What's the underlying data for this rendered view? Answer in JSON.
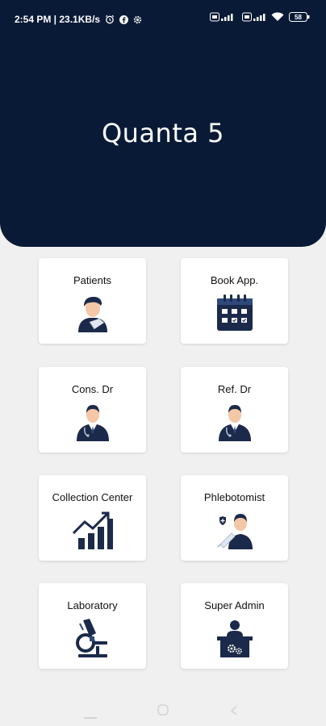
{
  "status_bar": {
    "time_and_speed": "2:54 PM | 23.1KB/s",
    "battery": "58"
  },
  "header": {
    "brand": "Quanta 5",
    "background_color": "#081a36"
  },
  "menu": {
    "items": [
      {
        "label": "Patients",
        "icon": "patient-icon"
      },
      {
        "label": "Book App.",
        "icon": "calendar-icon"
      },
      {
        "label": "Cons. Dr",
        "icon": "doctor-icon"
      },
      {
        "label": "Ref. Dr",
        "icon": "doctor-icon"
      },
      {
        "label": "Collection Center",
        "icon": "growth-chart-icon"
      },
      {
        "label": "Phlebotomist",
        "icon": "phlebotomist-icon"
      },
      {
        "label": "Laboratory",
        "icon": "microscope-icon"
      },
      {
        "label": "Super Admin",
        "icon": "admin-desk-icon"
      }
    ]
  },
  "colors": {
    "accent": "#081a36",
    "page_background": "#f0f0f0",
    "card_background": "#ffffff"
  }
}
